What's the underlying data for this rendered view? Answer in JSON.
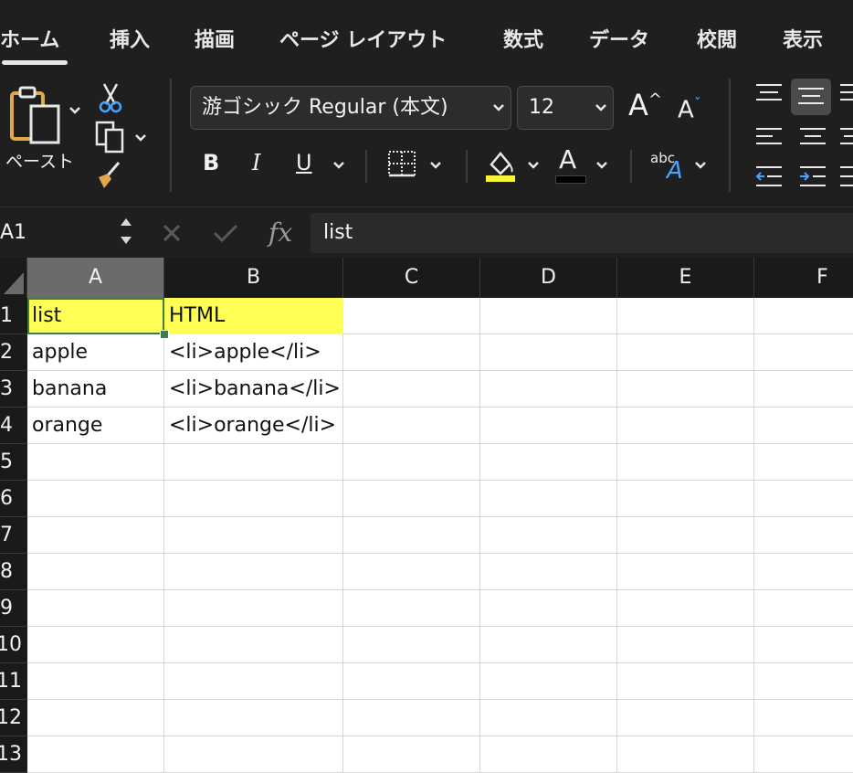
{
  "tabs": [
    "ホーム",
    "挿入",
    "描画",
    "ページ レイアウト",
    "数式",
    "データ",
    "校閲",
    "表示"
  ],
  "active_tab": "ホーム",
  "ribbon": {
    "paste_label": "ペースト",
    "font_name": "游ゴシック Regular (本文)",
    "font_size": "12",
    "bold": "B",
    "italic": "I",
    "underline": "U",
    "font_color_glyph": "A",
    "increase_font": "A",
    "decrease_font": "A",
    "orientation_abc": "abc",
    "orientation_a": "A",
    "highlight_color": "#f8f53a",
    "font_color": "#000000"
  },
  "formula_bar": {
    "name_box": "A1",
    "fx": "fx",
    "content": "list"
  },
  "sheet": {
    "columns": [
      "A",
      "B",
      "C",
      "D",
      "E",
      "F"
    ],
    "rows": [
      "1",
      "2",
      "3",
      "4",
      "5",
      "6",
      "7",
      "8",
      "9",
      "10",
      "11",
      "12",
      "13"
    ],
    "cells": [
      [
        "list",
        "HTML"
      ],
      [
        "apple",
        "<li>apple</li>"
      ],
      [
        "banana",
        "<li>banana</li>"
      ],
      [
        "orange",
        "<li>orange</li>"
      ]
    ],
    "highlight_fill": "#fefe55",
    "selected_cell": "A1"
  }
}
